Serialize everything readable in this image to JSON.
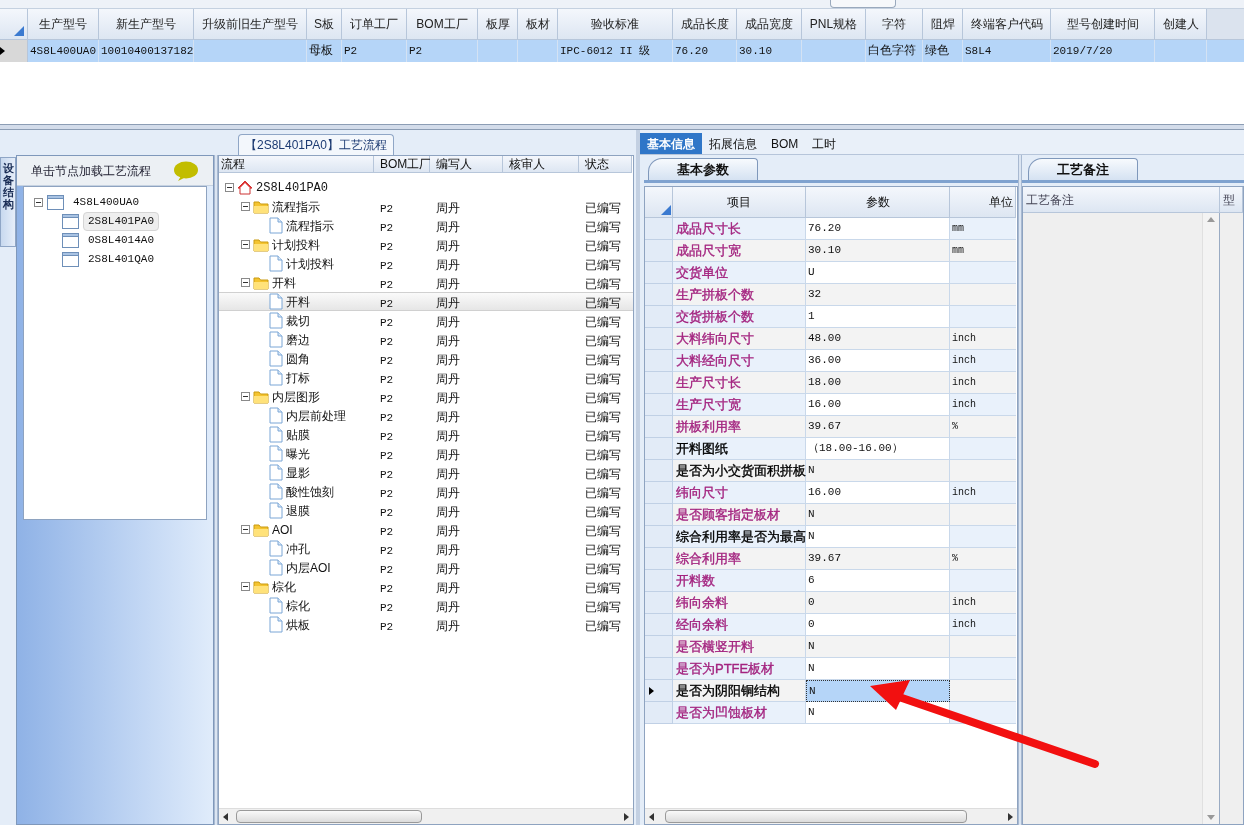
{
  "top_grid": {
    "columns": [
      "生产型号",
      "新生产型号",
      "升级前旧生产型号",
      "S板",
      "订单工厂",
      "BOM工厂",
      "板厚",
      "板材",
      "验收标准",
      "成品长度",
      "成品宽度",
      "PNL规格",
      "字符",
      "阻焊",
      "终端客户代码",
      "型号创建时间",
      "创建人"
    ],
    "rows": [
      {
        "selected": true,
        "cells": [
          "4S8L400UA0",
          "10010400137182",
          null,
          "母板",
          "P2",
          "P2",
          null,
          null,
          "IPC-6012 II 级",
          "76.20",
          "30.10",
          null,
          "白色字符",
          "绿色",
          "S8L4",
          "2019/7/20",
          null
        ]
      }
    ]
  },
  "side_tab": {
    "label": "设备结构"
  },
  "model_panel": {
    "title": "单击节点加载工艺流程",
    "tree": [
      {
        "label": "4S8L400UA0",
        "expanded": true,
        "selected": false,
        "children": [
          {
            "label": "2S8L401PA0",
            "selected": true
          },
          {
            "label": "0S8L4014A0",
            "selected": false
          },
          {
            "label": "2S8L401QA0",
            "selected": false
          }
        ]
      }
    ]
  },
  "process_panel": {
    "caption": "【2S8L401PA0】工艺流程",
    "columns": [
      "流程",
      "BOM工厂",
      "编写人",
      "核审人",
      "状态"
    ],
    "tree": [
      {
        "kind": "root",
        "label": "2S8L401PA0",
        "expanded": true,
        "selected": false,
        "children": [
          {
            "kind": "folder",
            "label": "流程指示",
            "bom": "P2",
            "writer": "周丹",
            "status": "已编写",
            "expanded": true,
            "selected": false,
            "children": [
              {
                "kind": "file",
                "label": "流程指示",
                "bom": "P2",
                "writer": "周丹",
                "status": "已编写",
                "selected": false
              }
            ]
          },
          {
            "kind": "folder",
            "label": "计划投料",
            "bom": "P2",
            "writer": "周丹",
            "status": "已编写",
            "expanded": true,
            "selected": false,
            "children": [
              {
                "kind": "file",
                "label": "计划投料",
                "bom": "P2",
                "writer": "周丹",
                "status": "已编写",
                "selected": false
              }
            ]
          },
          {
            "kind": "folder",
            "label": "开料",
            "bom": "P2",
            "writer": "周丹",
            "status": "已编写",
            "expanded": true,
            "selected": false,
            "children": [
              {
                "kind": "file",
                "label": "开料",
                "bom": "P2",
                "writer": "周丹",
                "status": "已编写",
                "selected": true
              },
              {
                "kind": "file",
                "label": "裁切",
                "bom": "P2",
                "writer": "周丹",
                "status": "已编写",
                "selected": false
              },
              {
                "kind": "file",
                "label": "磨边",
                "bom": "P2",
                "writer": "周丹",
                "status": "已编写",
                "selected": false
              },
              {
                "kind": "file",
                "label": "圆角",
                "bom": "P2",
                "writer": "周丹",
                "status": "已编写",
                "selected": false
              },
              {
                "kind": "file",
                "label": "打标",
                "bom": "P2",
                "writer": "周丹",
                "status": "已编写",
                "selected": false
              }
            ]
          },
          {
            "kind": "folder",
            "label": "内层图形",
            "bom": "P2",
            "writer": "周丹",
            "status": "已编写",
            "expanded": true,
            "selected": false,
            "children": [
              {
                "kind": "file",
                "label": "内层前处理",
                "bom": "P2",
                "writer": "周丹",
                "status": "已编写",
                "selected": false
              },
              {
                "kind": "file",
                "label": "贴膜",
                "bom": "P2",
                "writer": "周丹",
                "status": "已编写",
                "selected": false
              },
              {
                "kind": "file",
                "label": "曝光",
                "bom": "P2",
                "writer": "周丹",
                "status": "已编写",
                "selected": false
              },
              {
                "kind": "file",
                "label": "显影",
                "bom": "P2",
                "writer": "周丹",
                "status": "已编写",
                "selected": false
              },
              {
                "kind": "file",
                "label": "酸性蚀刻",
                "bom": "P2",
                "writer": "周丹",
                "status": "已编写",
                "selected": false
              },
              {
                "kind": "file",
                "label": "退膜",
                "bom": "P2",
                "writer": "周丹",
                "status": "已编写",
                "selected": false
              }
            ]
          },
          {
            "kind": "folder",
            "label": "AOI",
            "bom": "P2",
            "writer": "周丹",
            "status": "已编写",
            "expanded": true,
            "selected": false,
            "children": [
              {
                "kind": "file",
                "label": "冲孔",
                "bom": "P2",
                "writer": "周丹",
                "status": "已编写",
                "selected": false
              },
              {
                "kind": "file",
                "label": "内层AOI",
                "bom": "P2",
                "writer": "周丹",
                "status": "已编写",
                "selected": false
              }
            ]
          },
          {
            "kind": "folder",
            "label": "棕化",
            "bom": "P2",
            "writer": "周丹",
            "status": "已编写",
            "expanded": true,
            "selected": false,
            "children": [
              {
                "kind": "file",
                "label": "棕化",
                "bom": "P2",
                "writer": "周丹",
                "status": "已编写",
                "selected": false
              },
              {
                "kind": "file",
                "label": "烘板",
                "bom": "P2",
                "writer": "周丹",
                "status": "已编写",
                "selected": false
              }
            ]
          }
        ]
      }
    ]
  },
  "info_tabs": [
    {
      "label": "基本信息",
      "selected": true
    },
    {
      "label": "拓展信息",
      "selected": false
    },
    {
      "label": "BOM",
      "selected": false
    },
    {
      "label": "工时",
      "selected": false
    }
  ],
  "params_panel": {
    "tab": "基本参数",
    "columns": [
      "项目",
      "参数",
      "单位"
    ],
    "rows": [
      {
        "label": "成品尺寸长",
        "value": "76.20",
        "unit": "mm",
        "color": "#a3237f",
        "selected": false
      },
      {
        "label": "成品尺寸宽",
        "value": "30.10",
        "unit": "mm",
        "color": "#a3237f",
        "selected": false
      },
      {
        "label": "交货单位",
        "value": "U",
        "unit": null,
        "color": "#a3237f",
        "selected": false
      },
      {
        "label": "生产拼板个数",
        "value": "32",
        "unit": null,
        "color": "#a3237f",
        "selected": false
      },
      {
        "label": "交货拼板个数",
        "value": "1",
        "unit": null,
        "color": "#a3237f",
        "selected": false
      },
      {
        "label": "大料纬向尺寸",
        "value": "48.00",
        "unit": "inch",
        "color": "#a3237f",
        "selected": false
      },
      {
        "label": "大料经向尺寸",
        "value": "36.00",
        "unit": "inch",
        "color": "#a3237f",
        "selected": false
      },
      {
        "label": "生产尺寸长",
        "value": "18.00",
        "unit": "inch",
        "color": "#a3237f",
        "selected": false
      },
      {
        "label": "生产尺寸宽",
        "value": "16.00",
        "unit": "inch",
        "color": "#a3237f",
        "selected": false
      },
      {
        "label": "拼板利用率",
        "value": "39.67",
        "unit": "%",
        "color": "#a3237f",
        "selected": false
      },
      {
        "label": "开料图纸",
        "value": "（18.00-16.00）",
        "unit": null,
        "color": "#000000",
        "selected": false
      },
      {
        "label": "是否为小交货面积拼板",
        "value": "N",
        "unit": null,
        "color": "#000000",
        "selected": false
      },
      {
        "label": "纬向尺寸",
        "value": "16.00",
        "unit": "inch",
        "color": "#a3237f",
        "selected": false
      },
      {
        "label": "是否顾客指定板材",
        "value": "N",
        "unit": null,
        "color": "#a3237f",
        "selected": false
      },
      {
        "label": "综合利用率是否为最高",
        "value": "N",
        "unit": null,
        "color": "#000000",
        "selected": false
      },
      {
        "label": "综合利用率",
        "value": "39.67",
        "unit": "%",
        "color": "#a3237f",
        "selected": false
      },
      {
        "label": "开料数",
        "value": "6",
        "unit": null,
        "color": "#a3237f",
        "selected": false
      },
      {
        "label": "纬向余料",
        "value": "0",
        "unit": "inch",
        "color": "#a3237f",
        "selected": false
      },
      {
        "label": "经向余料",
        "value": "0",
        "unit": "inch",
        "color": "#a3237f",
        "selected": false
      },
      {
        "label": "是否横竖开料",
        "value": "N",
        "unit": null,
        "color": "#a3237f",
        "selected": false
      },
      {
        "label": "是否为PTFE板材",
        "value": "N",
        "unit": null,
        "color": "#a3237f",
        "selected": false
      },
      {
        "label": "是否为阴阳铜结构",
        "value": "N",
        "unit": null,
        "color": "#000000",
        "selected": true
      },
      {
        "label": "是否为凹蚀板材",
        "value": "N",
        "unit": null,
        "color": "#a3237f",
        "selected": false
      }
    ]
  },
  "notes_panel": {
    "tab": "工艺备注",
    "columns": [
      "工艺备注",
      "型"
    ]
  }
}
